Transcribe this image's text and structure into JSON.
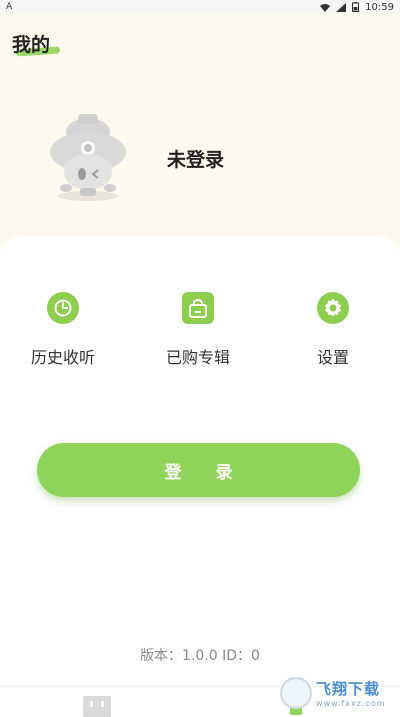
{
  "status_bar": {
    "left_indicator": "A",
    "time": "10:59"
  },
  "header": {
    "title": "我的"
  },
  "profile": {
    "login_status": "未登录"
  },
  "menu": {
    "items": [
      {
        "label": "历史收听",
        "icon": "clock-icon"
      },
      {
        "label": "已购专辑",
        "icon": "shopping-bag-icon"
      },
      {
        "label": "设置",
        "icon": "gear-icon"
      }
    ]
  },
  "actions": {
    "login_label": "登 录"
  },
  "footer": {
    "version_text": "版本：1.0.0   ID：0"
  },
  "watermark": {
    "main_text": "飞翔下载",
    "sub_text": "www.fxxz.com"
  },
  "colors": {
    "accent": "#8fd45a",
    "background": "#fdf9ee"
  }
}
